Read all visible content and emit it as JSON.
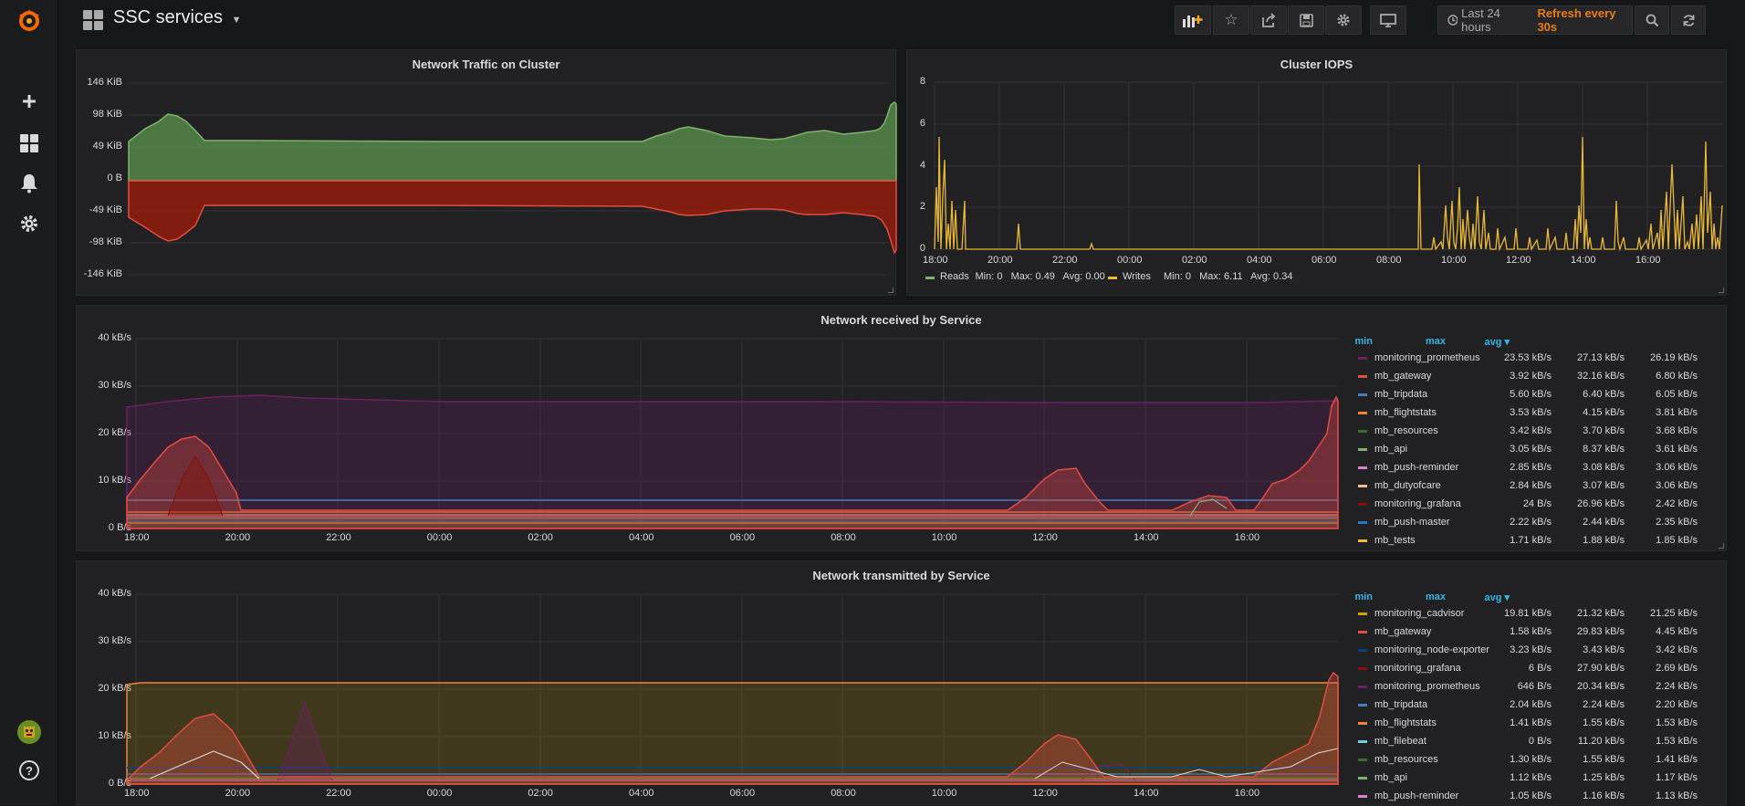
{
  "app": {
    "dashboard_title": "SSC services"
  },
  "toolbar": {
    "time_range": "Last 24 hours",
    "refresh": "Refresh every 30s"
  },
  "sidebar": {
    "icons": [
      "grafana-logo-icon",
      "plus-icon",
      "dashboards-icon",
      "bell-icon",
      "gear-icon"
    ],
    "help": "?"
  },
  "colors": {
    "accent": "#eb7b18",
    "legend_header": "#33b5e5",
    "green": "#629e51",
    "red": "#bf1b00",
    "yellow": "#eab839"
  },
  "panels": {
    "network_traffic": {
      "title": "Network Traffic on Cluster",
      "y_ticks": [
        "146 KiB",
        "98 KiB",
        "49 KiB",
        "0 B",
        "-49 KiB",
        "-98 KiB",
        "-146 KiB"
      ]
    },
    "cluster_iops": {
      "title": "Cluster IOPS",
      "y_ticks": [
        "8",
        "6",
        "4",
        "2",
        "0"
      ],
      "x_ticks": [
        "18:00",
        "20:00",
        "22:00",
        "00:00",
        "02:00",
        "04:00",
        "06:00",
        "08:00",
        "10:00",
        "12:00",
        "14:00",
        "16:00"
      ],
      "legend": [
        {
          "name": "Reads",
          "stats": "Min: 0   Max: 0.49   Avg: 0.00",
          "color": "#7eb26d"
        },
        {
          "name": "Writes",
          "stats": "Min: 0   Max: 6.11   Avg: 0.34",
          "color": "#eab839"
        }
      ]
    },
    "network_received": {
      "title": "Network received by Service",
      "y_ticks": [
        "40 kB/s",
        "30 kB/s",
        "20 kB/s",
        "10 kB/s",
        "0 B/s"
      ],
      "x_ticks": [
        "18:00",
        "20:00",
        "22:00",
        "00:00",
        "02:00",
        "04:00",
        "06:00",
        "08:00",
        "10:00",
        "12:00",
        "14:00",
        "16:00"
      ],
      "legend_headers": {
        "min": "min",
        "max": "max",
        "avg": "avg ▾"
      },
      "legend": [
        {
          "name": "monitoring_prometheus",
          "min": "23.53 kB/s",
          "max": "27.13 kB/s",
          "avg": "26.19 kB/s",
          "color": "#6d1f62"
        },
        {
          "name": "mb_gateway",
          "min": "3.92 kB/s",
          "max": "32.16 kB/s",
          "avg": "6.80 kB/s",
          "color": "#e24d42"
        },
        {
          "name": "mb_tripdata",
          "min": "5.60 kB/s",
          "max": "6.40 kB/s",
          "avg": "6.05 kB/s",
          "color": "#447ebc"
        },
        {
          "name": "mb_flightstats",
          "min": "3.53 kB/s",
          "max": "4.15 kB/s",
          "avg": "3.81 kB/s",
          "color": "#ef843c"
        },
        {
          "name": "mb_resources",
          "min": "3.42 kB/s",
          "max": "3.70 kB/s",
          "avg": "3.68 kB/s",
          "color": "#3f6833"
        },
        {
          "name": "mb_api",
          "min": "3.05 kB/s",
          "max": "8.37 kB/s",
          "avg": "3.61 kB/s",
          "color": "#7eb26d"
        },
        {
          "name": "mb_push-reminder",
          "min": "2.85 kB/s",
          "max": "3.08 kB/s",
          "avg": "3.06 kB/s",
          "color": "#d683ce"
        },
        {
          "name": "mb_dutyofcare",
          "min": "2.84 kB/s",
          "max": "3.07 kB/s",
          "avg": "3.06 kB/s",
          "color": "#f9ba8f"
        },
        {
          "name": "monitoring_grafana",
          "min": "24 B/s",
          "max": "26.96 kB/s",
          "avg": "2.42 kB/s",
          "color": "#890f02"
        },
        {
          "name": "mb_push-master",
          "min": "2.22 kB/s",
          "max": "2.44 kB/s",
          "avg": "2.35 kB/s",
          "color": "#1f78c1"
        },
        {
          "name": "mb_tests",
          "min": "1.71 kB/s",
          "max": "1.88 kB/s",
          "avg": "1.85 kB/s",
          "color": "#eab839"
        }
      ]
    },
    "network_transmitted": {
      "title": "Network transmitted by Service",
      "y_ticks": [
        "40 kB/s",
        "30 kB/s",
        "20 kB/s",
        "10 kB/s",
        "0 B/s"
      ],
      "x_ticks": [
        "18:00",
        "20:00",
        "22:00",
        "00:00",
        "02:00",
        "04:00",
        "06:00",
        "08:00",
        "10:00",
        "12:00",
        "14:00",
        "16:00"
      ],
      "legend_headers": {
        "min": "min",
        "max": "max",
        "avg": "avg ▾"
      },
      "legend": [
        {
          "name": "monitoring_cadvisor",
          "min": "19.81 kB/s",
          "max": "21.32 kB/s",
          "avg": "21.25 kB/s",
          "color": "#cca300"
        },
        {
          "name": "mb_gateway",
          "min": "1.58 kB/s",
          "max": "29.83 kB/s",
          "avg": "4.45 kB/s",
          "color": "#e24d42"
        },
        {
          "name": "monitoring_node-exporter",
          "min": "3.23 kB/s",
          "max": "3.43 kB/s",
          "avg": "3.42 kB/s",
          "color": "#0a437c"
        },
        {
          "name": "monitoring_grafana",
          "min": "6 B/s",
          "max": "27.90 kB/s",
          "avg": "2.69 kB/s",
          "color": "#890f02"
        },
        {
          "name": "monitoring_prometheus",
          "min": "646 B/s",
          "max": "20.34 kB/s",
          "avg": "2.24 kB/s",
          "color": "#6d1f62"
        },
        {
          "name": "mb_tripdata",
          "min": "2.04 kB/s",
          "max": "2.24 kB/s",
          "avg": "2.20 kB/s",
          "color": "#447ebc"
        },
        {
          "name": "mb_flightstats",
          "min": "1.41 kB/s",
          "max": "1.55 kB/s",
          "avg": "1.53 kB/s",
          "color": "#ef843c"
        },
        {
          "name": "mb_filebeat",
          "min": "0 B/s",
          "max": "11.20 kB/s",
          "avg": "1.53 kB/s",
          "color": "#6ed0e0"
        },
        {
          "name": "mb_resources",
          "min": "1.30 kB/s",
          "max": "1.55 kB/s",
          "avg": "1.41 kB/s",
          "color": "#3f6833"
        },
        {
          "name": "mb_api",
          "min": "1.12 kB/s",
          "max": "1.25 kB/s",
          "avg": "1.17 kB/s",
          "color": "#7eb26d"
        },
        {
          "name": "mb_push-reminder",
          "min": "1.05 kB/s",
          "max": "1.16 kB/s",
          "avg": "1.13 kB/s",
          "color": "#d683ce"
        }
      ]
    }
  }
}
